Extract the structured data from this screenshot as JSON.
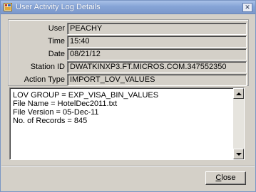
{
  "window": {
    "title": "User Activity Log Details",
    "title_close_glyph": "✕"
  },
  "fields": [
    {
      "label": "User",
      "value": "PEACHY"
    },
    {
      "label": "Time",
      "value": "15:40"
    },
    {
      "label": "Date",
      "value": "08/21/12"
    },
    {
      "label": "Station ID",
      "value": "DWATKINXP3.FT.MICROS.COM.347552350"
    },
    {
      "label": "Action Type",
      "value": "IMPORT_LOV_VALUES"
    }
  ],
  "details": {
    "lines": [
      "LOV GROUP = EXP_VISA_BIN_VALUES",
      "File Name = HotelDec2011.txt",
      "File Version = 05-Dec-11",
      "No. of Records = 845"
    ]
  },
  "footer": {
    "close_label_first": "C",
    "close_label_rest": "lose"
  }
}
